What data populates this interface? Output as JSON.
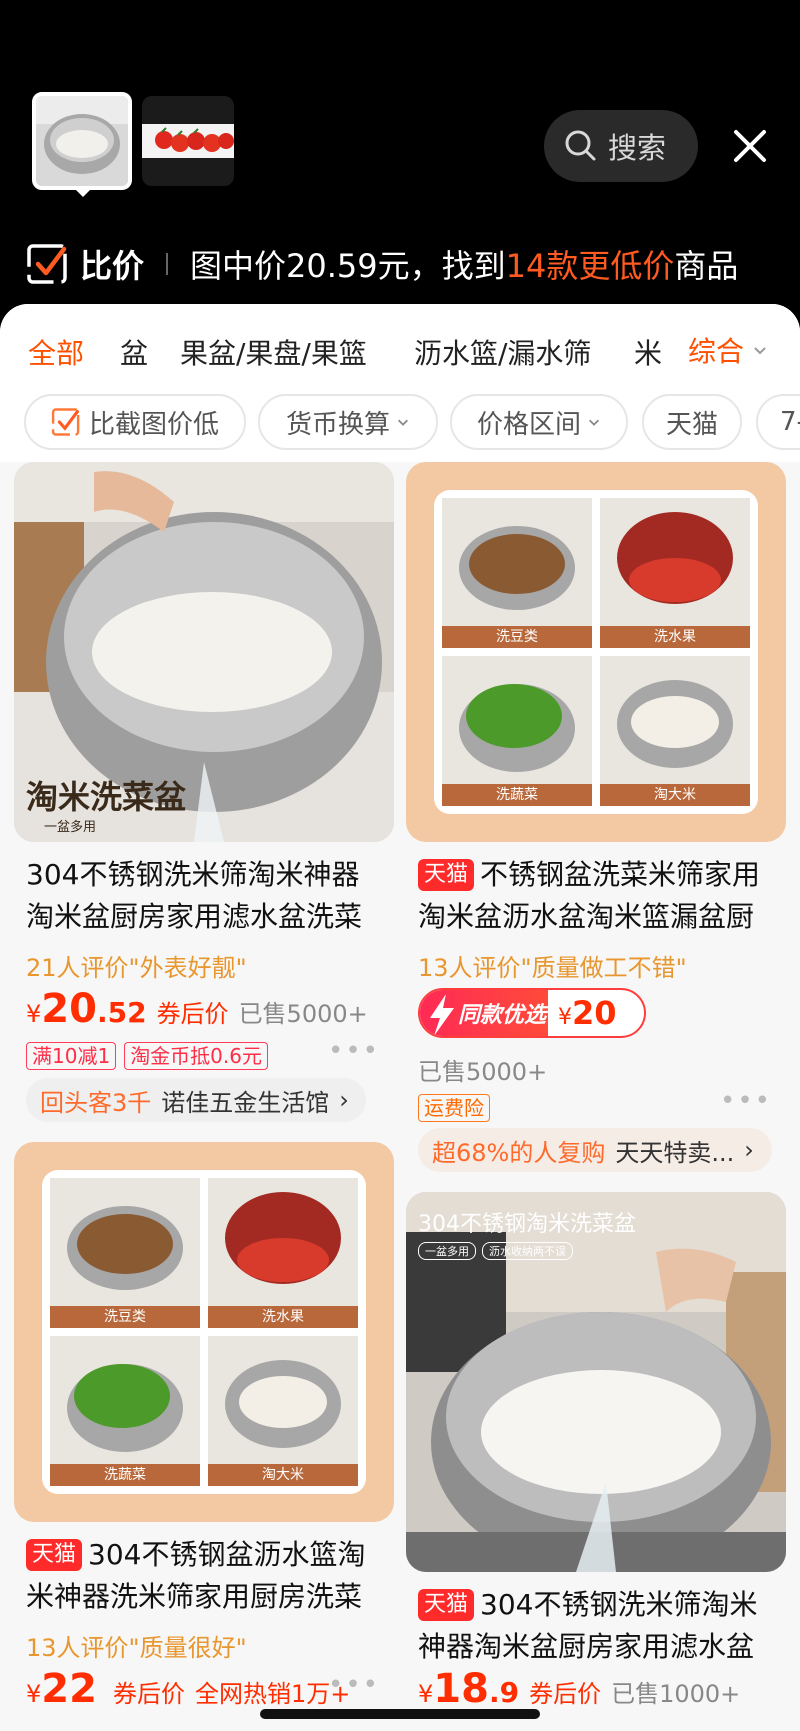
{
  "header": {
    "search_label": "搜索",
    "thumbnails": [
      {
        "name": "rice-bowl-thumbnail"
      },
      {
        "name": "tomato-thumbnail"
      }
    ]
  },
  "compare_bar": {
    "title": "比价",
    "text_prefix": "图中价20.59元，找到",
    "highlight": "14款更低价",
    "text_suffix": "商品"
  },
  "category_tabs": [
    "全部",
    "盆",
    "果盆/果盘/果篮",
    "沥水篮/漏水筛",
    "米"
  ],
  "sort_label": "综合",
  "filter_chips": [
    "比截图价低",
    "货币换算",
    "价格区间",
    "天猫",
    "7-"
  ],
  "products": [
    {
      "image_caption": "淘米洗菜盆",
      "image_subcaption": "一盆多用",
      "tmall": "",
      "title_line1": "304不锈钢洗米筛淘米神器",
      "title_line2": "淘米盆厨房家用滤水盆洗菜",
      "review": "21人评价\"外表好靓\"",
      "price_yen": "¥",
      "price_int": "20",
      "price_dec": ".52",
      "price_note": "券后价",
      "sold": "已售5000+",
      "tags": [
        "满10减1",
        "淘金币抵0.6元"
      ],
      "store_accent": "回头客3千",
      "store_name": "诺佳五金生活馆"
    },
    {
      "tiles": [
        "洗豆类",
        "洗水果",
        "洗蔬菜",
        "淘大米"
      ],
      "tmall": "天猫",
      "title_line1": "不锈钢盆洗菜米筛家用",
      "title_line2": "淘米盆沥水盆淘米篮漏盆厨",
      "review": "13人评价\"质量做工不错\"",
      "deal_badge": "同款优选",
      "deal_yen": "¥",
      "deal_price": "20",
      "sold": "已售5000+",
      "tags": [
        "运费险"
      ],
      "store_accent": "超68%的人复购",
      "store_name": "天天特卖..."
    },
    {
      "tiles": [
        "洗豆类",
        "洗水果",
        "洗蔬菜",
        "淘大米"
      ],
      "tmall": "天猫",
      "title_line1": "304不锈钢盆沥水篮淘",
      "title_line2": "米神器洗米筛家用厨房洗菜",
      "review": "13人评价\"质量很好\"",
      "price_yen": "¥",
      "price_int": "22",
      "price_note": "券后价",
      "sold": "全网热销1万+"
    },
    {
      "image_caption": "304不锈钢淘米洗菜盆",
      "image_badges": [
        "一盆多用",
        "沥水收纳两不误"
      ],
      "tmall": "天猫",
      "title_line1": "304不锈钢洗米筛淘米",
      "title_line2": "神器淘米盆厨房家用滤水盆",
      "price_yen": "¥",
      "price_int": "18",
      "price_dec": ".9",
      "price_note": "券后价",
      "sold": "已售1000+"
    }
  ],
  "more_label": "•••",
  "colors": {
    "accent": "#ff5000",
    "price": "#ff2d00",
    "tmall": "#ff2a2a",
    "review": "#e8962e"
  }
}
